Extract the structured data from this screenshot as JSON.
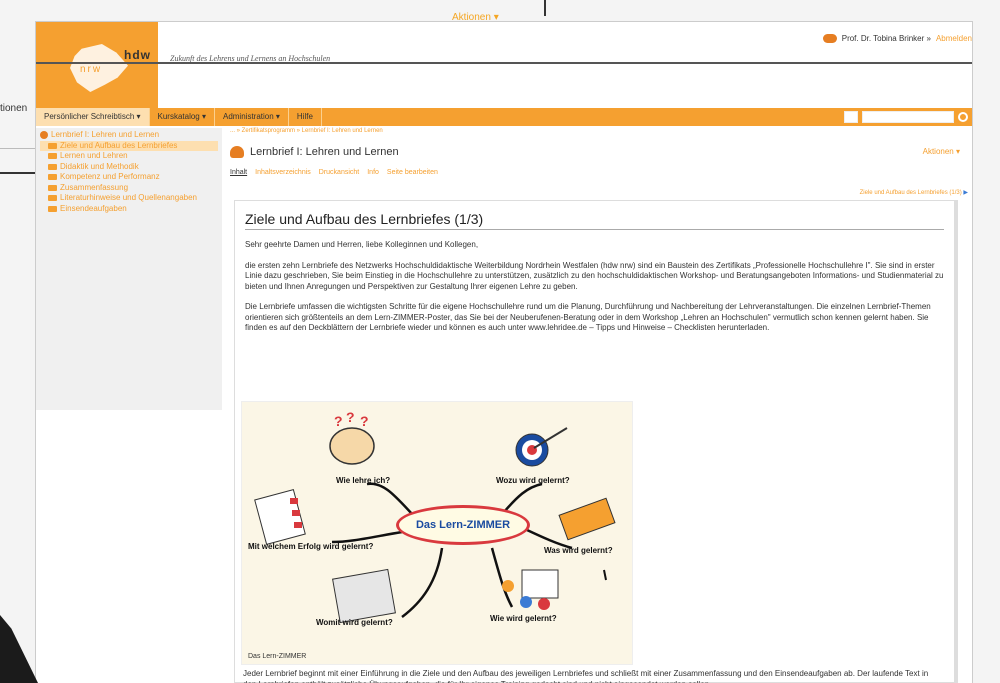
{
  "background": {
    "left_text": "tionen",
    "aktionen_label": "Aktionen"
  },
  "header": {
    "logo_top": "hdw",
    "logo_bottom": "nrw",
    "tagline": "Zukunft des Lehrens und Lernens an Hochschulen",
    "user_name": "Prof. Dr. Tobina Brinker »",
    "logout_label": "Abmelden"
  },
  "nav": {
    "items": [
      {
        "label": "Persönlicher Schreibtisch ▾"
      },
      {
        "label": "Kurskatalog ▾"
      },
      {
        "label": "Administration ▾"
      },
      {
        "label": "Hilfe"
      }
    ],
    "search_placeholder": ""
  },
  "tree": {
    "root": "Lernbrief I: Lehren und Lernen",
    "items": [
      {
        "label": "Ziele und Aufbau des Lernbriefes"
      },
      {
        "label": "Lernen und Lehren"
      },
      {
        "label": "Didaktik und Methodik"
      },
      {
        "label": "Kompetenz und Performanz"
      },
      {
        "label": "Zusammenfassung"
      },
      {
        "label": "Literaturhinweise und Quellenangaben"
      },
      {
        "label": "Einsendeaufgaben"
      }
    ]
  },
  "content": {
    "breadcrumb": "... » Zertifikatsprogramm » Lernbrief I: Lehren und Lernen",
    "title": "Lernbrief I: Lehren und Lernen",
    "aktionen": "Aktionen",
    "tabs": [
      "Inhalt",
      "Inhaltsverzeichnis",
      "Druckansicht",
      "Info",
      "Seite bearbeiten"
    ],
    "pager": "Ziele und Aufbau des Lernbriefes (1/3)",
    "heading": "Ziele und Aufbau des Lernbriefes (1/3)",
    "para1": "Sehr geehrte Damen und Herren, liebe Kolleginnen und Kollegen,",
    "para2": "die ersten zehn Lernbriefe des Netzwerks Hochschuldidaktische Weiterbildung Nordrhein Westfalen (hdw nrw) sind ein Baustein des Zertifikats „Professionelle Hochschullehre I\". Sie sind in erster Linie dazu geschrieben, Sie beim Einstieg in die Hochschullehre zu unterstützen, zusätzlich zu den hochschuldidaktischen Workshop- und Beratungsangeboten Informations- und Studienmaterial zu bieten und Ihnen Anregungen und Perspektiven zur Gestaltung Ihrer eigenen Lehre zu geben.",
    "para3": "Die Lernbriefe umfassen die wichtigsten Schritte für die eigene Hochschullehre rund um die Planung, Durchführung und Nachbereitung der Lehrveranstaltungen. Die einzelnen Lernbrief-Themen orientieren sich größtenteils an dem Lern-ZIMMER-Poster, das Sie bei der Neuberufenen-Beratung oder in dem Workshop „Lehren an Hochschulen\" vermutlich schon kennen gelernt haben. Sie finden es auf den Deckblättern der Lernbriefe wieder und können es auch unter www.lehridee.de – Tipps und Hinweise – Checklisten herunterladen.",
    "mindmap": {
      "center": "Das Lern-ZIMMER",
      "caption": "Das Lern-ZIMMER",
      "labels": {
        "wie": "Wie lehre ich?",
        "wozu": "Wozu wird gelernt?",
        "erfolg": "Mit welchem Erfolg wird gelernt?",
        "was": "Was wird gelernt?",
        "womit": "Womit wird gelernt?",
        "wie_gelernt": "Wie wird gelernt?"
      }
    },
    "para4": "Jeder Lernbrief beginnt mit einer Einführung in die Ziele und den Aufbau des jeweiligen Lernbriefes und schließt mit einer Zusammenfassung und den Einsendeaufgaben ab. Der laufende Text in den Lernbriefen enthält zusätzliche Übungsaufgaben, die für Ihr eigenes Training gedacht sind und nicht eingesendet werden sollen."
  },
  "colors": {
    "accent": "#f5a030",
    "nav_active": "#fddfb0",
    "mindmap_border": "#d9393e",
    "mindmap_text": "#1a4ba0"
  }
}
